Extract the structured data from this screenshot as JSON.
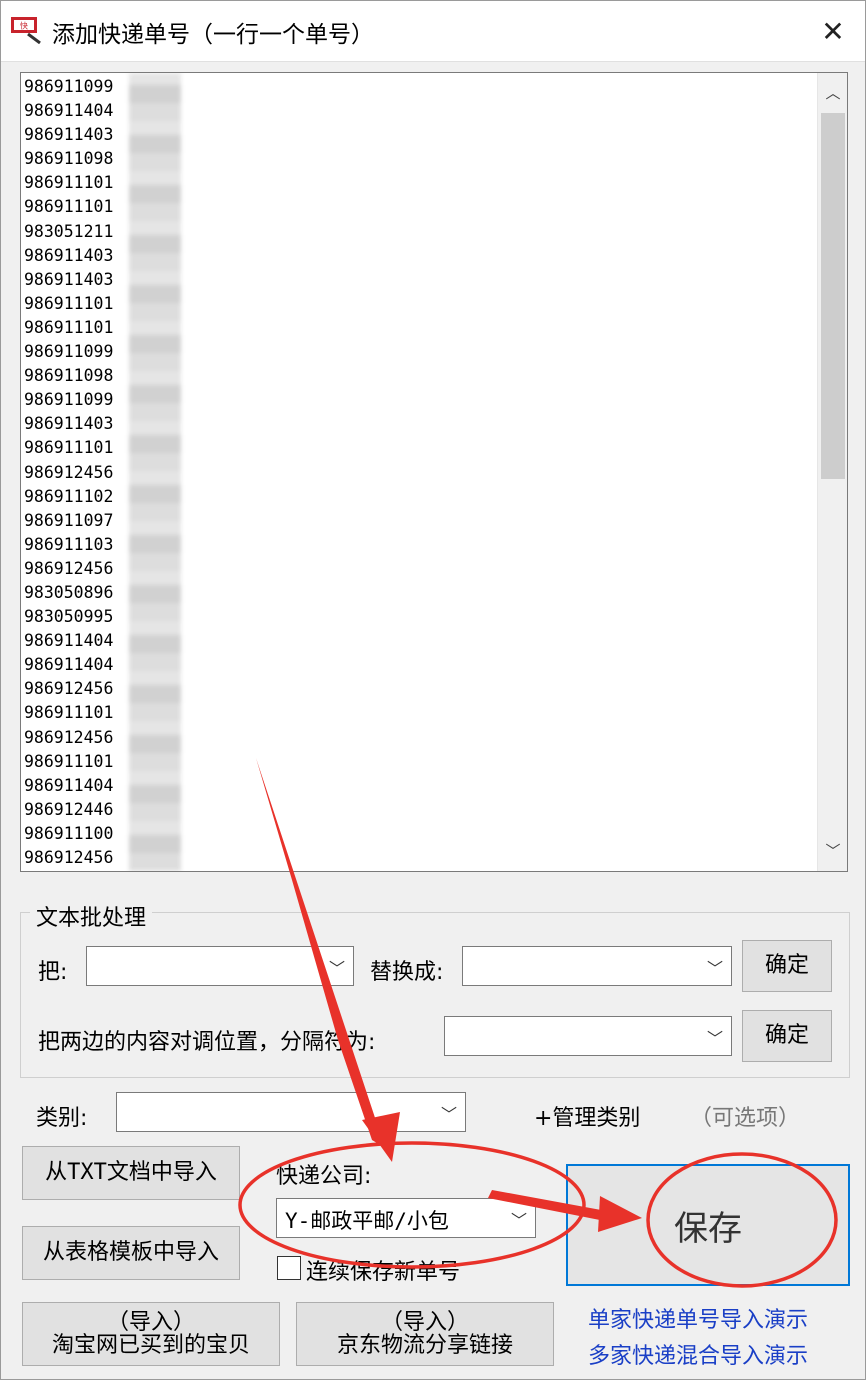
{
  "window": {
    "title": "添加快递单号（一行一个单号）",
    "app_icon": "app-logo-icon",
    "close_icon": "close-icon"
  },
  "tracking_numbers": [
    "986911099",
    "986911404",
    "986911403",
    "986911098",
    "986911101",
    "986911101",
    "983051211",
    "986911403",
    "986911403",
    "986911101",
    "986911101",
    "986911099",
    "986911098",
    "986911099",
    "986911403",
    "986911101",
    "986912456",
    "986911102",
    "986911097",
    "986911103",
    "986912456",
    "983050896",
    "983050995",
    "986911404",
    "986911404",
    "986912456",
    "986911101",
    "986912456",
    "986911101",
    "986911404",
    "986912446",
    "986911100",
    "986912456"
  ],
  "batch": {
    "group_title": "文本批处理",
    "from_label": "把:",
    "replace_label": "替换成:",
    "confirm1": "确定",
    "swap_label": "把两边的内容对调位置，分隔符为:",
    "confirm2": "确定"
  },
  "category": {
    "label": "类别:",
    "manage": "+管理类别",
    "optional": "（可选项）"
  },
  "import": {
    "txt": "从TXT文档中导入",
    "template": "从表格模板中导入",
    "taobao_line1": "（导入）",
    "taobao_line2": "淘宝网已买到的宝贝",
    "jd_line1": "（导入）",
    "jd_line2": "京东物流分享链接"
  },
  "courier": {
    "label": "快递公司:",
    "value": "Y-邮政平邮/小包",
    "continuous_save": "连续保存新单号"
  },
  "save_label": "保存",
  "links": {
    "single": "单家快递单号导入演示",
    "multi": "多家快递混合导入演示"
  },
  "colors": {
    "annotation_red": "#e8322a",
    "link_blue": "#1a3fc6",
    "focus_blue": "#0078d7"
  }
}
